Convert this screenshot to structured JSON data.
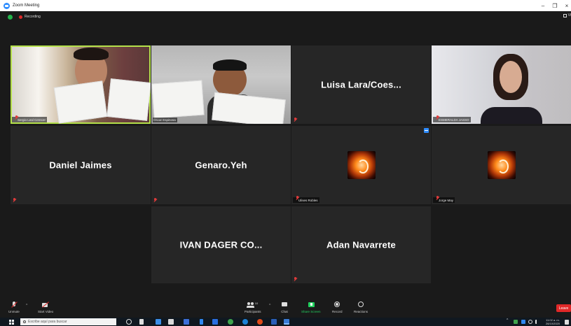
{
  "window": {
    "title": "Zoom Meeting",
    "controls": [
      "–",
      "❐",
      "×"
    ]
  },
  "recording": {
    "label": "Recording"
  },
  "view": {
    "label": "Vi"
  },
  "participants": {
    "row1": [
      {
        "label": "Sergio Leal Cerecer",
        "kind": "video"
      },
      {
        "label": "Oscar Espinosa",
        "kind": "video"
      },
      {
        "display_name": "Luisa  Lara/Coes...",
        "kind": "name"
      },
      {
        "label": "ESMERALDA JASSO",
        "kind": "video"
      }
    ],
    "row2": [
      {
        "display_name": "Daniel Jaimes",
        "kind": "name"
      },
      {
        "display_name": "Genaro.Yeh",
        "kind": "name"
      },
      {
        "label": "Ulises Robles",
        "kind": "avatar"
      },
      {
        "label": "Jorge May",
        "kind": "avatar"
      }
    ],
    "row3": [
      {
        "display_name": "IVAN DAGER CO...",
        "kind": "name"
      },
      {
        "display_name": "Adan Navarrete",
        "kind": "name"
      }
    ]
  },
  "toolbar": {
    "unmute": "Unmute",
    "start_video": "Start Video",
    "participants": "Participants",
    "participants_count": "10",
    "chat": "Chat",
    "share_screen": "Share Screen",
    "record": "Record",
    "reactions": "Reactions",
    "leave": "Leave"
  },
  "taskbar": {
    "search_placeholder": "Escribe aquí para buscar",
    "time": "11:02 a. m.",
    "date": "26/10/2020"
  },
  "colors": {
    "active_speaker": "#b4e04a",
    "recording_red": "#e02828",
    "share_green": "#23d160",
    "leave_red": "#e02828",
    "zoom_blue": "#2d8cff"
  }
}
